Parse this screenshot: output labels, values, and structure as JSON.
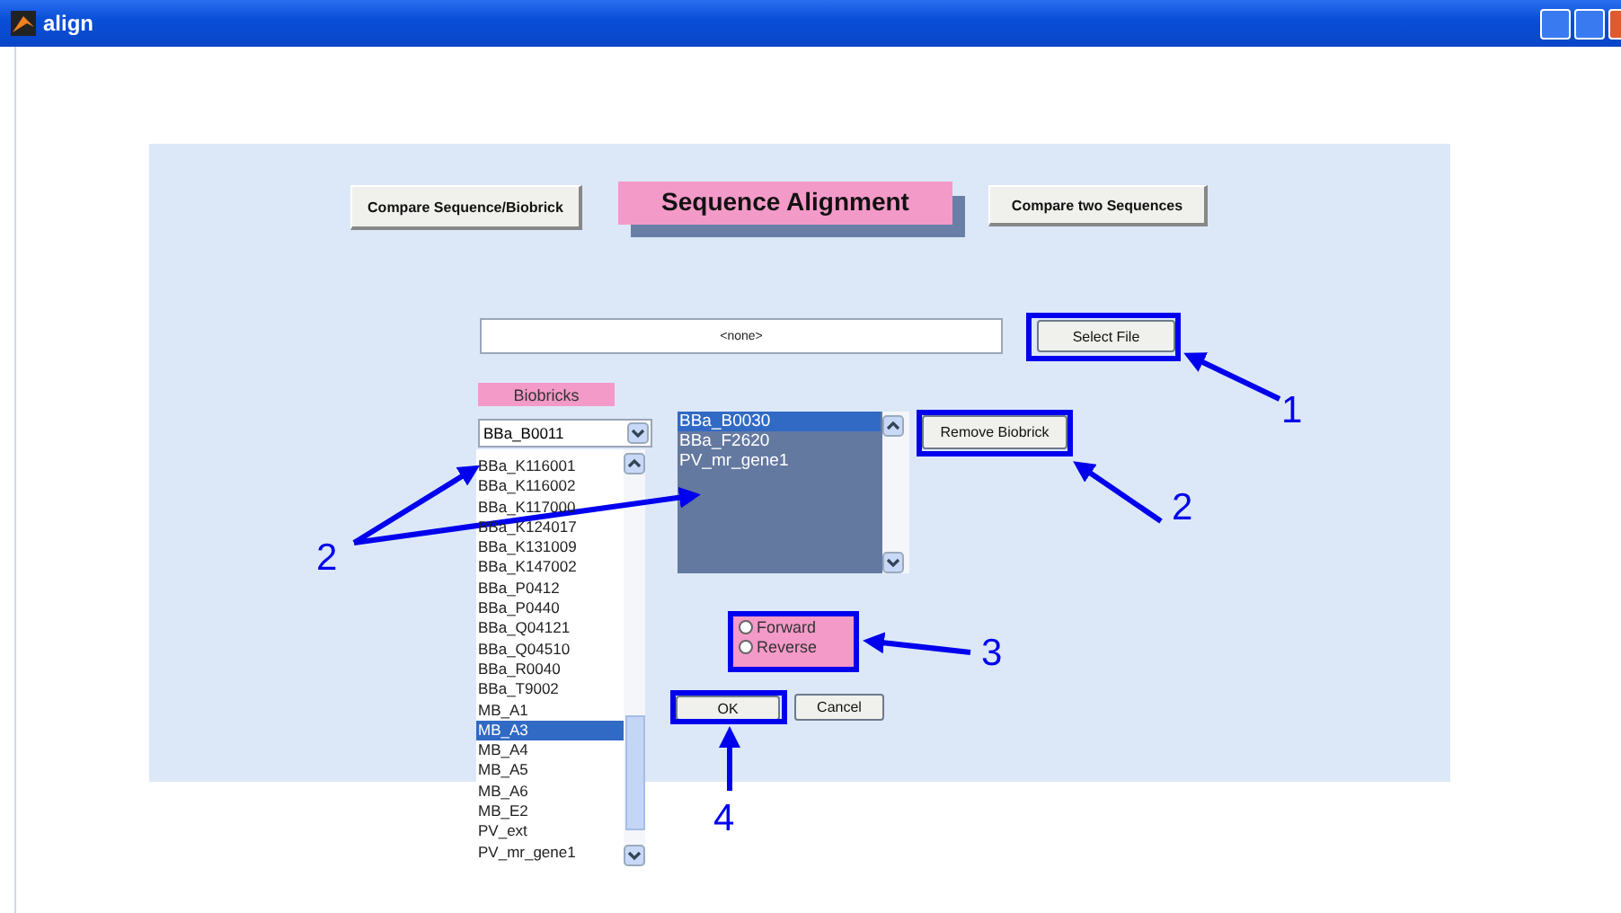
{
  "window": {
    "title": "align"
  },
  "nav_buttons": [
    {
      "label": "Compare Sequence/Biobrick"
    },
    {
      "label": "Compare two Sequences"
    }
  ],
  "heading": "Sequence Alignment",
  "file_field": {
    "value": "<none>"
  },
  "select_file_button": "Select File",
  "biobricks_label": "Biobricks",
  "biobrick_dropdown": {
    "value": "BBa_B0011"
  },
  "biobrick_list": [
    {
      "label": "BBa_K116001",
      "selected": false
    },
    {
      "label": "BBa_K116002",
      "selected": false
    },
    {
      "label": "BBa_K117000",
      "selected": false
    },
    {
      "label": "BBa_K124017",
      "selected": false
    },
    {
      "label": "BBa_K131009",
      "selected": false
    },
    {
      "label": "BBa_K147002",
      "selected": false
    },
    {
      "label": "BBa_P0412",
      "selected": false
    },
    {
      "label": "BBa_P0440",
      "selected": false
    },
    {
      "label": "BBa_Q04121",
      "selected": false
    },
    {
      "label": "BBa_Q04510",
      "selected": false
    },
    {
      "label": "BBa_R0040",
      "selected": false
    },
    {
      "label": "BBa_T9002",
      "selected": false
    },
    {
      "label": "MB_A1",
      "selected": false
    },
    {
      "label": "MB_A3",
      "selected": true
    },
    {
      "label": "MB_A4",
      "selected": false
    },
    {
      "label": "MB_A5",
      "selected": false
    },
    {
      "label": "MB_A6",
      "selected": false
    },
    {
      "label": "MB_E2",
      "selected": false
    },
    {
      "label": "PV_ext",
      "selected": false
    },
    {
      "label": "PV_mr_gene1",
      "selected": false
    }
  ],
  "chosen_list": [
    {
      "label": "BBa_B0030",
      "selected": true
    },
    {
      "label": "BBa_F2620",
      "selected": false
    },
    {
      "label": "PV_mr_gene1",
      "selected": false
    }
  ],
  "remove_button": "Remove Biobrick",
  "direction": [
    {
      "label": "Forward",
      "selected": false
    },
    {
      "label": "Reverse",
      "selected": false
    }
  ],
  "ok_button": "OK",
  "cancel_button": "Cancel",
  "annotations": [
    {
      "label": "1"
    },
    {
      "label": "2"
    },
    {
      "label": "2"
    },
    {
      "label": "3"
    },
    {
      "label": "4"
    }
  ]
}
